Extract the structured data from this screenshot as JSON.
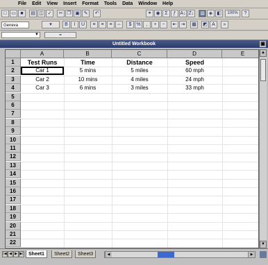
{
  "menu": {
    "items": [
      "File",
      "Edit",
      "View",
      "Insert",
      "Format",
      "Tools",
      "Data",
      "Window",
      "Help"
    ]
  },
  "toolbar": {
    "font_name": "Geneva",
    "zoom": "100%"
  },
  "formula_bar": {
    "name_box": "",
    "fx_label": "="
  },
  "workbook": {
    "title": "Untitled Workbook"
  },
  "sheet": {
    "columns": [
      "A",
      "B",
      "C",
      "D",
      "E"
    ],
    "rows": [
      "1",
      "2",
      "3",
      "4",
      "5",
      "6",
      "7",
      "8",
      "9",
      "10",
      "11",
      "12",
      "13",
      "14",
      "15",
      "16",
      "17",
      "18",
      "19",
      "20",
      "21",
      "22"
    ],
    "headers": [
      "Test Runs",
      "Time",
      "Distance",
      "Speed"
    ],
    "data": [
      [
        "Car 1",
        "5 mins",
        "5 miles",
        "60 mph"
      ],
      [
        "Car 2",
        "10 mins",
        "4 miles",
        "24 mph"
      ],
      [
        "Car 3",
        "6 mins",
        "3 miles",
        "33 mph"
      ]
    ]
  },
  "tabs": {
    "items": [
      "Sheet1",
      "Sheet2",
      "Sheet3"
    ],
    "selected": 0
  },
  "colors": {
    "title_bar": "#2a3a6a",
    "scroll_thumb": "#3a6ad0"
  }
}
